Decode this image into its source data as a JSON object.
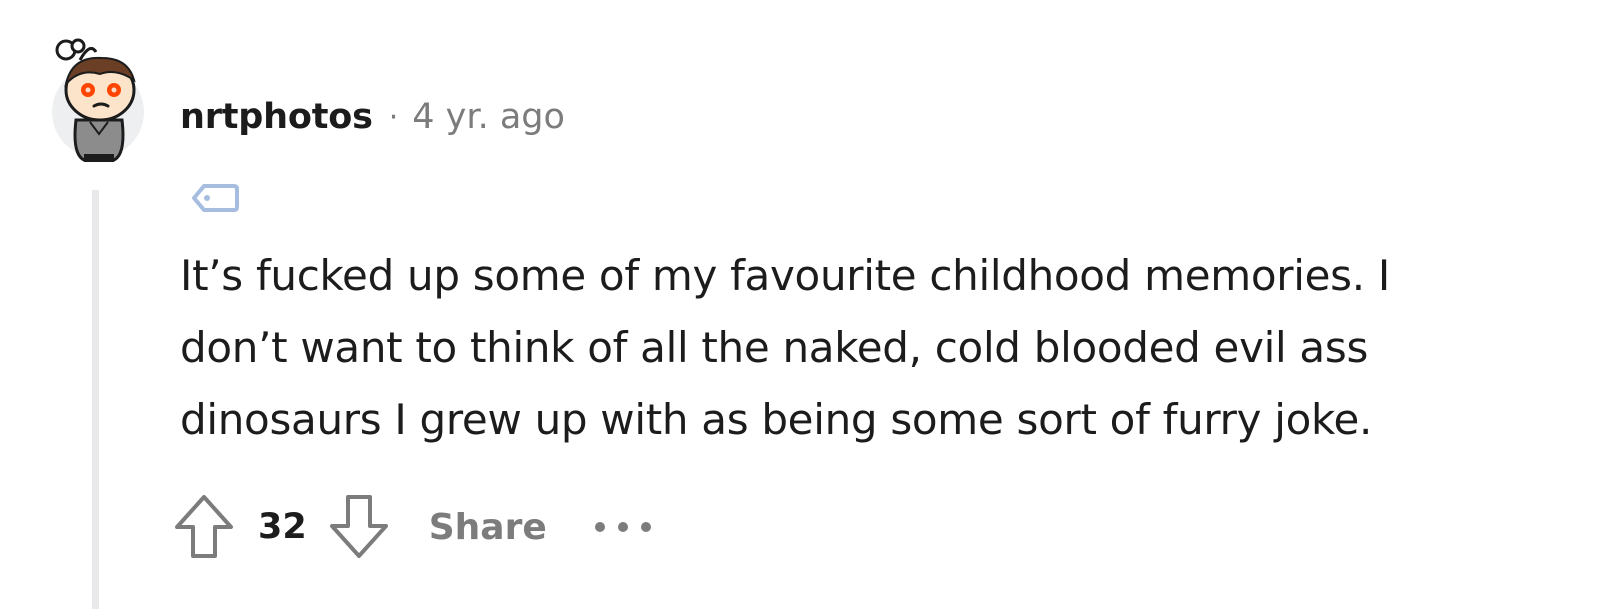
{
  "comment": {
    "author": "nrtphotos",
    "separator": "·",
    "timestamp": "4 yr. ago",
    "avatar_icon": "snoo-avatar-icon",
    "flair_icon": "tag-icon",
    "body": [
      "It’s fucked up some of my favourite childhood memories. I",
      "don’t want to think of all the naked, cold blooded evil ass",
      "dinosaurs I grew up with as being some sort of furry joke."
    ],
    "score": "32",
    "share_label": "Share",
    "more_icon": "more-options-icon"
  },
  "colors": {
    "text": "#1c1c1c",
    "muted": "#7c7c7c",
    "thread_line": "#e9e9ec",
    "flair_icon": "#a7bde0",
    "avatar_eyes": "#ff4500"
  }
}
